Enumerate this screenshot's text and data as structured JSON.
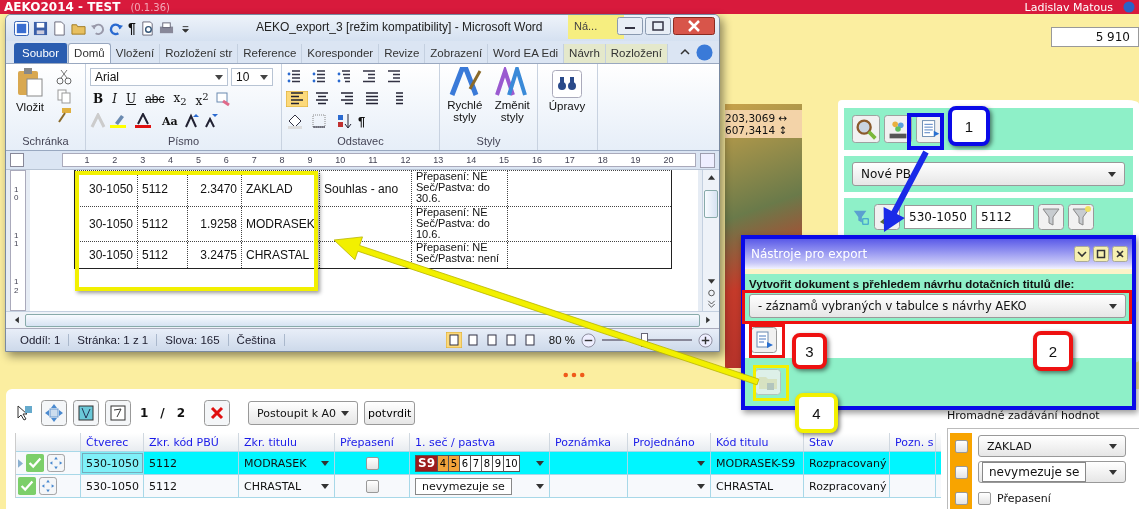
{
  "app": {
    "title": "AEKO2014 - TEST",
    "version": "(0.1.36)",
    "user": "Ladislav Matous",
    "count_field": "5 910"
  },
  "map": {
    "coordinates": [
      "203,3069 ↔",
      "607,3414 ↕"
    ]
  },
  "side_panel": {
    "layer_select": "Nové PB",
    "filter_fields": [
      "530-1050",
      "5112"
    ]
  },
  "grid_toolbar": {
    "page": "1",
    "separator": "/",
    "pages": "2",
    "action_select": "Postoupit k A0",
    "confirm_button": "potvrdit"
  },
  "table": {
    "columns": [
      "Čtverec",
      "Zkr. kód PBÚ",
      "Zkr. titulu",
      "Přepasení",
      "1. seč / pastva",
      "Poznámka",
      "Projednáno",
      "Kód titulu",
      "Stav",
      "Pozn. s"
    ],
    "rows": [
      {
        "selected": true,
        "square": "530-1050",
        "pbu": "5112",
        "title": "MODRASEK",
        "overgrazing": false,
        "mowing": {
          "kind": "months",
          "months": [
            {
              "label": "S9",
              "color": "#9c1b1b"
            },
            {
              "label": "4",
              "color": "#f2a33a"
            },
            {
              "label": "5",
              "color": "#f2a33a"
            },
            {
              "label": "6",
              "color": "#ffffff"
            },
            {
              "label": "7",
              "color": "#ffffff"
            },
            {
              "label": "8",
              "color": "#ffffff"
            },
            {
              "label": "9",
              "color": "#ffffff"
            },
            {
              "label": "10",
              "color": "#ffffff"
            }
          ]
        },
        "title_code": "MODRASEK-S9",
        "status": "Rozpracovaný"
      },
      {
        "selected": false,
        "square": "530-1050",
        "pbu": "5112",
        "title": "CHRASTAL",
        "overgrazing": false,
        "mowing": {
          "kind": "text",
          "text": "nevymezuje se"
        },
        "title_code": "CHRASTAL",
        "status": "Rozpracovaný"
      }
    ]
  },
  "bulk_panel": {
    "title": "Hromadné zadávání hodnot",
    "rows": [
      {
        "kind": "select",
        "value": "ZAKLAD",
        "checked": false
      },
      {
        "kind": "field",
        "value": "nevymezuje se",
        "checked": false
      },
      {
        "kind": "checkbox",
        "label": "Přepasení",
        "checked": false,
        "option_checked": false
      }
    ]
  },
  "word": {
    "title": "AEKO_export_3 [režim kompatibility]  -  Microsoft Word",
    "quick_access_mark": "¶",
    "context_tab": "Ná...",
    "tabs": [
      {
        "label": "Soubor",
        "kind": "file",
        "selected": false
      },
      {
        "label": "Domů",
        "kind": "normal",
        "selected": true
      },
      {
        "label": "Vložení",
        "kind": "normal",
        "selected": false
      },
      {
        "label": "Rozložení str",
        "kind": "normal",
        "selected": false
      },
      {
        "label": "Reference",
        "kind": "normal",
        "selected": false
      },
      {
        "label": "Koresponder",
        "kind": "normal",
        "selected": false
      },
      {
        "label": "Revize",
        "kind": "normal",
        "selected": false
      },
      {
        "label": "Zobrazení",
        "kind": "normal",
        "selected": false
      },
      {
        "label": "Word EA Edi",
        "kind": "normal",
        "selected": false
      },
      {
        "label": "Návrh",
        "kind": "context",
        "selected": false
      },
      {
        "label": "Rozložení",
        "kind": "context",
        "selected": false
      }
    ],
    "ribbon": {
      "paste": "Vložit",
      "font": "Arial",
      "size": "10",
      "format": [
        "B",
        "I",
        "U",
        "abc",
        "x$_{2}$",
        "x$^{2}$"
      ],
      "case": "Aa",
      "pilcrow": "¶",
      "quick_styles": "Rychlé styly",
      "change_styles": "Změnit styly",
      "editing": "Úpravy",
      "groups": [
        "Schránka",
        "Písmo",
        "Odstavec",
        "Styly"
      ]
    },
    "ruler": [
      "1",
      "2",
      "3",
      "4",
      "5",
      "6",
      "7",
      "8",
      "9",
      "10",
      "11",
      "12",
      "13",
      "14",
      "15",
      "16",
      "17",
      "18",
      "19",
      "20"
    ],
    "vertical_ruler": [
      "10",
      "11",
      "12"
    ],
    "table": [
      {
        "code": "30-1050",
        "pbu": "5112",
        "area": "2.3470",
        "title": "ZAKLAD",
        "consent": "Souhlas - ano",
        "notes": [
          "Přepasení: NE",
          "Seč/Pastva: do",
          "30.6."
        ]
      },
      {
        "code": "30-1050",
        "pbu": "5112",
        "area": "1.9258",
        "title": "MODRASEK",
        "notes": [
          "Přepasení: NE",
          "Seč/Pastva: do",
          "10.6."
        ]
      },
      {
        "code": "30-1050",
        "pbu": "5112",
        "area": "3.2475",
        "title": "CHRASTAL",
        "notes": [
          "Přepasení: NE",
          "Seč/Pastva: není"
        ]
      }
    ],
    "status": [
      "Oddíl: 1",
      "Stránka: 1 z 1",
      "Slova: 165",
      "Čeština"
    ],
    "zoom": "80 %",
    "zoom_slider": {
      "level": 0.47
    }
  },
  "export_dialog": {
    "title": "Nástroje pro export",
    "prompt": "Vytvořit dokument s přehledem návrhu dotačních titulů dle:",
    "select": "- záznamů vybraných v tabulce s návrhy AEKO"
  },
  "callouts": [
    {
      "label": "1",
      "color": "#0a0ae8"
    },
    {
      "label": "2",
      "color": "#ee1111"
    },
    {
      "label": "3",
      "color": "#ee1111"
    },
    {
      "label": "4",
      "color": "#f2f000"
    }
  ]
}
